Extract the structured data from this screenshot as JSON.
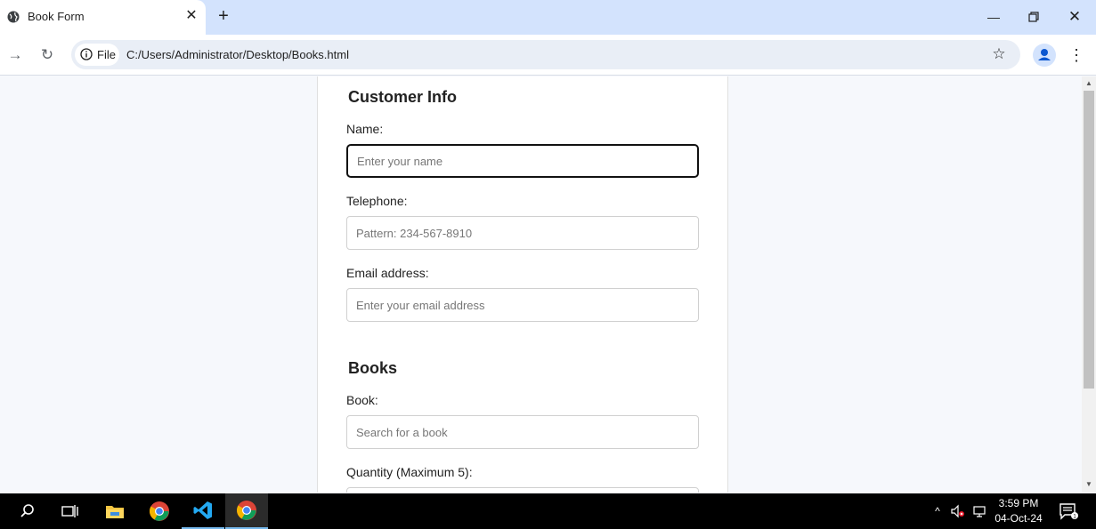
{
  "browser": {
    "tab": {
      "title": "Book Form"
    },
    "address": {
      "scheme_chip": "File",
      "url": "C:/Users/Administrator/Desktop/Books.html"
    }
  },
  "page": {
    "customer_section": {
      "title": "Customer Info",
      "name_label": "Name:",
      "name_placeholder": "Enter your name",
      "phone_label": "Telephone:",
      "phone_placeholder": "Pattern: 234-567-8910",
      "email_label": "Email address:",
      "email_placeholder": "Enter your email address"
    },
    "books_section": {
      "title": "Books",
      "book_label": "Book:",
      "book_placeholder": "Search for a book",
      "quantity_label": "Quantity (Maximum 5):"
    }
  },
  "taskbar": {
    "clock": {
      "time": "3:59 PM",
      "date": "04-Oct-24"
    }
  },
  "colors": {
    "tab_strip": "#d3e3fd",
    "omnibox": "#e9eef6",
    "page_bg": "#f6f8fc",
    "vscode_blue": "#23a9f2",
    "taskbar_accent": "#76b9ed"
  }
}
